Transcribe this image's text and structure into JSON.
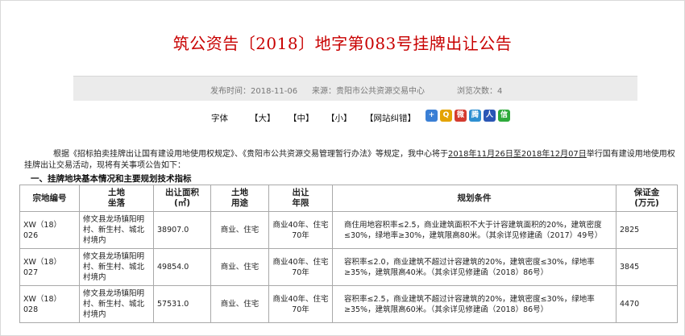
{
  "title": "筑公资告〔2018〕地字第083号挂牌出让公告",
  "meta": {
    "publish_time": "发布时间：2018-11-06",
    "source": "来源：贵阳市公共资源交易中心",
    "views": "浏览次数：4"
  },
  "toolbar": {
    "font_label": "字体",
    "large": "【大】",
    "medium": "【中】",
    "small": "【小】",
    "report": "【网站纠错】",
    "share_icons": [
      "plus-share-icon",
      "qzone-icon",
      "weibo-icon",
      "tencent-icon",
      "renren-icon",
      "wechat-icon"
    ],
    "icon_colors": [
      "#3a7fd5",
      "#e4a300",
      "#d43b2f",
      "#2e8fd1",
      "#2a56b5",
      "#2eaa3b"
    ]
  },
  "intro": {
    "p1": "根据《招标拍卖挂牌出让国有建设用地使用权规定》、《贵阳市公共资源交易管理暂行办法》等规定，我中心将于",
    "dates": "2018年11月26日至2018年12月07日",
    "p2": "举行国有建设用地使用权挂牌出让交易活动，现将有关事项公告如下："
  },
  "section_title": "一、挂牌地块基本情况和主要规划技术指标",
  "table": {
    "headers": [
      "宗地编号",
      "土地\n坐落",
      "出让面积(㎡)",
      "土地\n用途",
      "出让\n年限",
      "规划条件",
      "保证金\n(万元)"
    ],
    "rows": [
      {
        "id": "XW（18）026",
        "location": "修文县龙场镇阳明村、新生村、城北村境内",
        "area": "38907.0",
        "use": "商业、住宅",
        "term": "商业40年、住宅70年",
        "conditions": "商住用地容积率≤2.5，商业建筑面积不大于计容建筑面积的20%，建筑密度≤30%，绿地率≥30%，建筑限高80米。（其余详见修建函（2017）49号）",
        "deposit": "2825"
      },
      {
        "id": "XW（18）027",
        "location": "修文县龙场镇阳明村、新生村、城北村境内",
        "area": "49854.0",
        "use": "商业、住宅",
        "term": "商业40年、住宅70年",
        "conditions": "容积率≤2.0，商业建筑不超过计容建筑的20%，建筑密度≤30%，绿地率≥35%，建筑限高40米。（其余详见修建函（2018）86号）",
        "deposit": "3845"
      },
      {
        "id": "XW（18）028",
        "location": "修文县龙场镇阳明村、新生村、城北村境内",
        "area": "57531.0",
        "use": "商业、住宅",
        "term": "商业40年、住宅70年",
        "conditions": "容积率≤2.5，商业建筑不超过计容建筑的20%，建筑密度≤30%，绿地率≥35%，建筑限高60米。（其余详见修建函（2018）86号）",
        "deposit": "4470"
      }
    ]
  }
}
